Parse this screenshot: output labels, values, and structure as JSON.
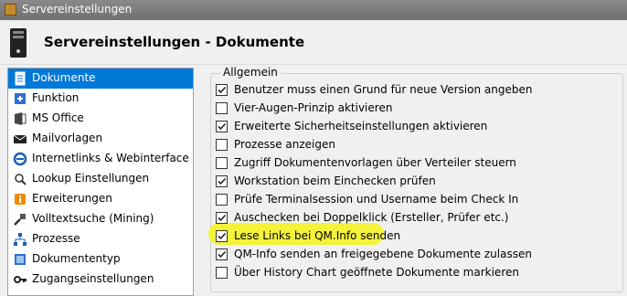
{
  "window": {
    "title": "Servereinstellungen"
  },
  "header": {
    "title": "Servereinstellungen - Dokumente"
  },
  "sidebar": {
    "items": [
      {
        "label": "Dokumente",
        "icon": "document-icon",
        "selected": true
      },
      {
        "label": "Funktion",
        "icon": "function-icon"
      },
      {
        "label": "MS Office",
        "icon": "ms-office-icon"
      },
      {
        "label": "Mailvorlagen",
        "icon": "mail-icon"
      },
      {
        "label": "Internetlinks & Webinterface",
        "icon": "internet-icon"
      },
      {
        "label": "Lookup Einstellungen",
        "icon": "lookup-icon"
      },
      {
        "label": "Erweiterungen",
        "icon": "extensions-icon"
      },
      {
        "label": "Volltextsuche (Mining)",
        "icon": "fulltext-search-icon"
      },
      {
        "label": "Prozesse",
        "icon": "processes-icon"
      },
      {
        "label": "Dokumententyp",
        "icon": "document-type-icon"
      },
      {
        "label": "Zugangseinstellungen",
        "icon": "key-icon"
      }
    ]
  },
  "main": {
    "group_label": "Allgemein",
    "options": [
      {
        "label": "Benutzer muss einen Grund für neue Version angeben",
        "checked": true
      },
      {
        "label": "Vier-Augen-Prinzip aktivieren",
        "checked": false
      },
      {
        "label": "Erweiterte Sicherheitseinstellungen aktivieren",
        "checked": true
      },
      {
        "label": "Prozesse anzeigen",
        "checked": false
      },
      {
        "label": "Zugriff Dokumentenvorlagen über Verteiler steuern",
        "checked": false
      },
      {
        "label": "Workstation beim Einchecken prüfen",
        "checked": true
      },
      {
        "label": "Prüfe Terminalsession und Username beim Check In",
        "checked": false
      },
      {
        "label": "Auschecken bei Doppelklick (Ersteller, Prüfer etc.)",
        "checked": true
      },
      {
        "label": "Lese Links bei QM.Info senden",
        "checked": true,
        "highlighted": true
      },
      {
        "label": "QM-Info senden an freigegebene Dokumente zulassen",
        "checked": true
      },
      {
        "label": "Über History Chart geöffnete Dokumente markieren",
        "checked": false
      }
    ]
  },
  "colors": {
    "selection": "#0078d7",
    "highlight": "#f3f12e"
  }
}
